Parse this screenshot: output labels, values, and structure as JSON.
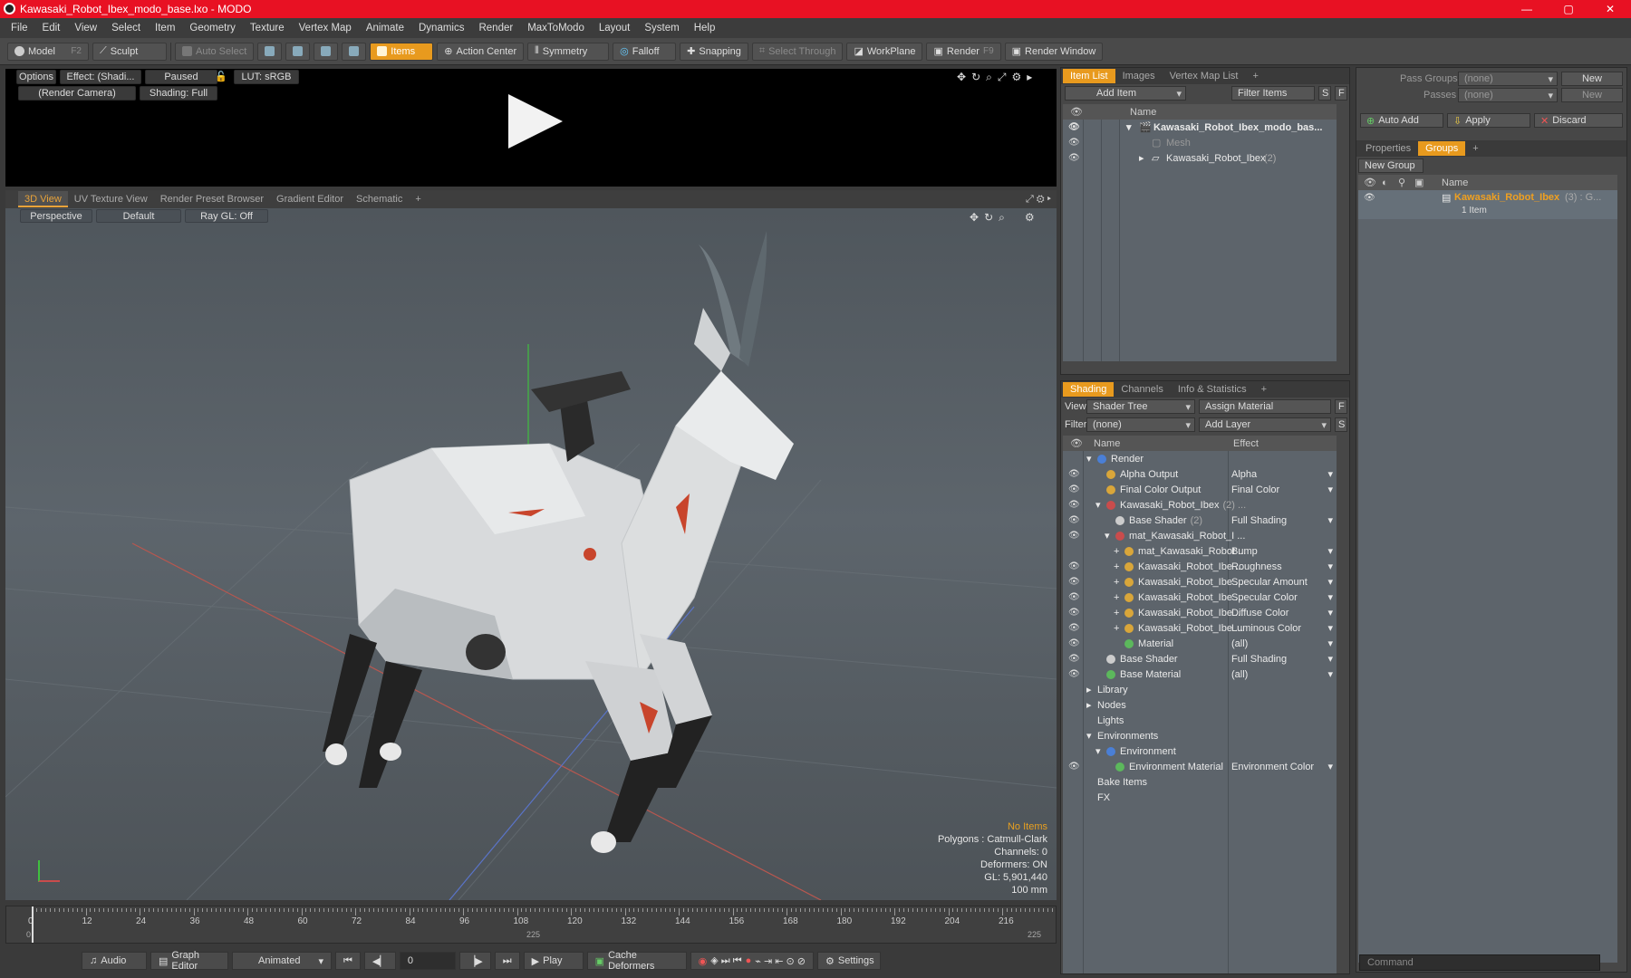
{
  "window": {
    "title": "Kawasaki_Robot_Ibex_modo_base.lxo - MODO",
    "min": "—",
    "max": "▢",
    "close": "✕"
  },
  "menu": [
    "File",
    "Edit",
    "View",
    "Select",
    "Item",
    "Geometry",
    "Texture",
    "Vertex Map",
    "Animate",
    "Dynamics",
    "Render",
    "MaxToModo",
    "Layout",
    "System",
    "Help"
  ],
  "toolbar": {
    "model": "Model",
    "model_key": "F2",
    "sculpt": "Sculpt",
    "auto_select": "Auto Select",
    "items": "Items",
    "action_center": "Action Center",
    "symmetry": "Symmetry",
    "falloff": "Falloff",
    "snapping": "Snapping",
    "select_through": "Select Through",
    "workplane": "WorkPlane",
    "render": "Render",
    "render_key": "F9",
    "render_window": "Render Window"
  },
  "preview": {
    "options": "Options",
    "effect": "Effect: (Shadi...",
    "paused": "Paused",
    "lut": "LUT: sRGB",
    "camera": "(Render Camera)",
    "shading": "Shading: Full"
  },
  "view_tabs": [
    "3D View",
    "UV Texture View",
    "Render Preset Browser",
    "Gradient Editor",
    "Schematic",
    "+"
  ],
  "viewport": {
    "perspective": "Perspective",
    "default": "Default",
    "raygl": "Ray GL: Off",
    "info": {
      "no_items": "No Items",
      "polygons": "Polygons : Catmull-Clark",
      "channels": "Channels: 0",
      "deformers": "Deformers: ON",
      "gl": "GL: 5,901,440",
      "scale": "100 mm"
    }
  },
  "timeline": {
    "ticks": [
      "0",
      "12",
      "24",
      "36",
      "48",
      "60",
      "72",
      "84",
      "96",
      "108",
      "120",
      "132",
      "144",
      "156",
      "168",
      "180",
      "192",
      "204",
      "216"
    ],
    "bottom_left": "0",
    "bottom_mid": "225",
    "bottom_right": "225"
  },
  "statusbar": {
    "audio": "Audio",
    "graph_editor": "Graph Editor",
    "animated": "Animated",
    "frame": "0",
    "play": "Play",
    "cache": "Cache Deformers",
    "settings": "Settings"
  },
  "item_list": {
    "tabs": [
      "Item List",
      "Images",
      "Vertex Map List",
      "+"
    ],
    "add_item": "Add Item",
    "filter": "Filter Items",
    "f": "F",
    "s": "S",
    "col_name": "Name",
    "rows": [
      {
        "label": "Kawasaki_Robot_Ibex_modo_bas...",
        "count": ""
      },
      {
        "label": "Mesh",
        "count": ""
      },
      {
        "label": "Kawasaki_Robot_Ibex",
        "count": "(2)"
      }
    ]
  },
  "shading": {
    "tabs": [
      "Shading",
      "Channels",
      "Info & Statistics",
      "+"
    ],
    "view_label": "View",
    "view_value": "Shader Tree",
    "assign": "Assign Material",
    "f": "F",
    "filter_label": "Filter",
    "filter_value": "(none)",
    "add_layer": "Add Layer",
    "s": "S",
    "col_name": "Name",
    "col_effect": "Effect",
    "rows": [
      {
        "name": "Render",
        "count": "",
        "effect": ""
      },
      {
        "name": "Alpha Output",
        "count": "",
        "effect": "Alpha"
      },
      {
        "name": "Final Color Output",
        "count": "",
        "effect": "Final Color"
      },
      {
        "name": "Kawasaki_Robot_Ibex",
        "count": "(2) ...",
        "effect": ""
      },
      {
        "name": "Base Shader",
        "count": "(2)",
        "effect": "Full Shading"
      },
      {
        "name": "mat_Kawasaki_Robot_I ...",
        "count": "",
        "effect": ""
      },
      {
        "name": "mat_Kawasaki_Robot ...",
        "count": "",
        "effect": "Bump"
      },
      {
        "name": "Kawasaki_Robot_Ibe ...",
        "count": "",
        "effect": "Roughness"
      },
      {
        "name": "Kawasaki_Robot_Ibe ...",
        "count": "",
        "effect": "Specular Amount"
      },
      {
        "name": "Kawasaki_Robot_Ibe ...",
        "count": "",
        "effect": "Specular Color"
      },
      {
        "name": "Kawasaki_Robot_Ibe ...",
        "count": "",
        "effect": "Diffuse Color"
      },
      {
        "name": "Kawasaki_Robot_Ibe ...",
        "count": "",
        "effect": "Luminous Color"
      },
      {
        "name": "Material",
        "count": "",
        "effect": "(all)"
      },
      {
        "name": "Base Shader",
        "count": "",
        "effect": "Full Shading"
      },
      {
        "name": "Base Material",
        "count": "",
        "effect": "(all)"
      },
      {
        "name": "Library",
        "count": "",
        "effect": ""
      },
      {
        "name": "Nodes",
        "count": "",
        "effect": ""
      },
      {
        "name": "Lights",
        "count": "",
        "effect": ""
      },
      {
        "name": "Environments",
        "count": "",
        "effect": ""
      },
      {
        "name": "Environment",
        "count": "",
        "effect": ""
      },
      {
        "name": "Environment Material",
        "count": "",
        "effect": "Environment Color"
      },
      {
        "name": "Bake Items",
        "count": "",
        "effect": ""
      },
      {
        "name": "FX",
        "count": "",
        "effect": ""
      }
    ]
  },
  "groups": {
    "pass_groups": "Pass Groups",
    "passes": "Passes",
    "none1": "(none)",
    "none2": "(none)",
    "new1": "New",
    "new2": "New",
    "auto_add": "Auto Add",
    "apply": "Apply",
    "discard": "Discard",
    "tabs": [
      "Properties",
      "Groups",
      "+"
    ],
    "new_group": "New Group",
    "col_name": "Name",
    "group_name": "Kawasaki_Robot_Ibex",
    "group_count": "(3) : G...",
    "group_items": "1 Item"
  },
  "command": {
    "placeholder": "Command"
  }
}
